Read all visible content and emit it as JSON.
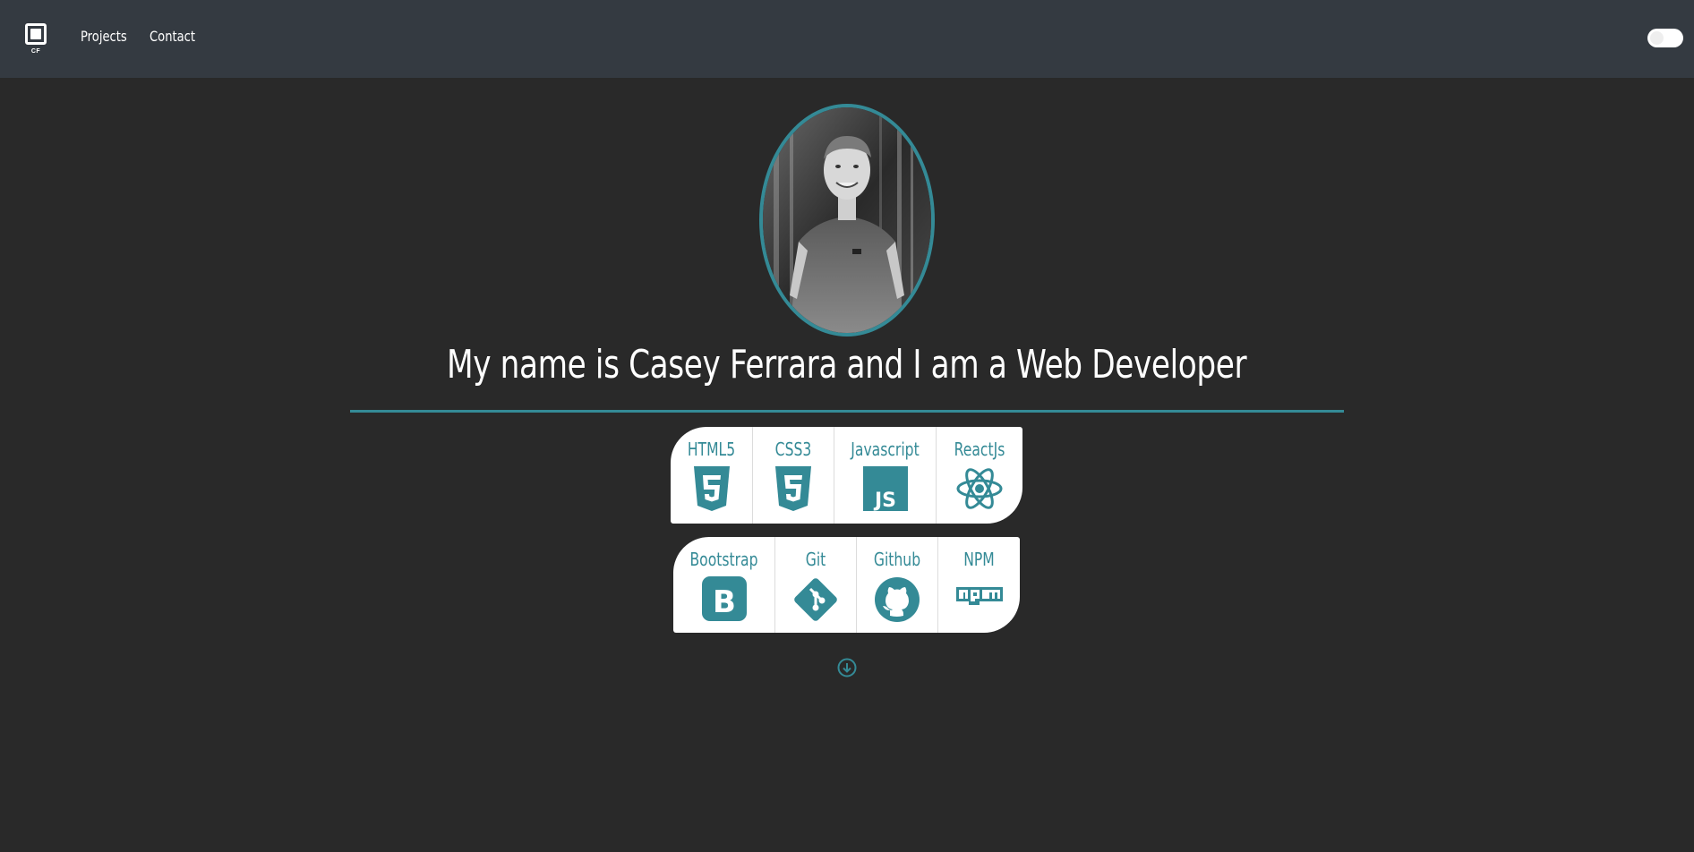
{
  "navbar": {
    "brand_text": "CF",
    "links": [
      {
        "label": "Projects"
      },
      {
        "label": "Contact"
      }
    ]
  },
  "hero": {
    "headline": "My name is Casey Ferrara and I am a Web Developer"
  },
  "skills": {
    "row1": [
      {
        "label": "HTML5",
        "icon": "html5-icon"
      },
      {
        "label": "CSS3",
        "icon": "css3-icon"
      },
      {
        "label": "Javascript",
        "icon": "javascript-icon"
      },
      {
        "label": "ReactJs",
        "icon": "react-icon"
      }
    ],
    "row2": [
      {
        "label": "Bootstrap",
        "icon": "bootstrap-icon"
      },
      {
        "label": "Git",
        "icon": "git-icon"
      },
      {
        "label": "Github",
        "icon": "github-icon"
      },
      {
        "label": "NPM",
        "icon": "npm-icon"
      }
    ]
  },
  "colors": {
    "accent": "#348a96",
    "navbar": "#343a41",
    "background": "#292929"
  }
}
